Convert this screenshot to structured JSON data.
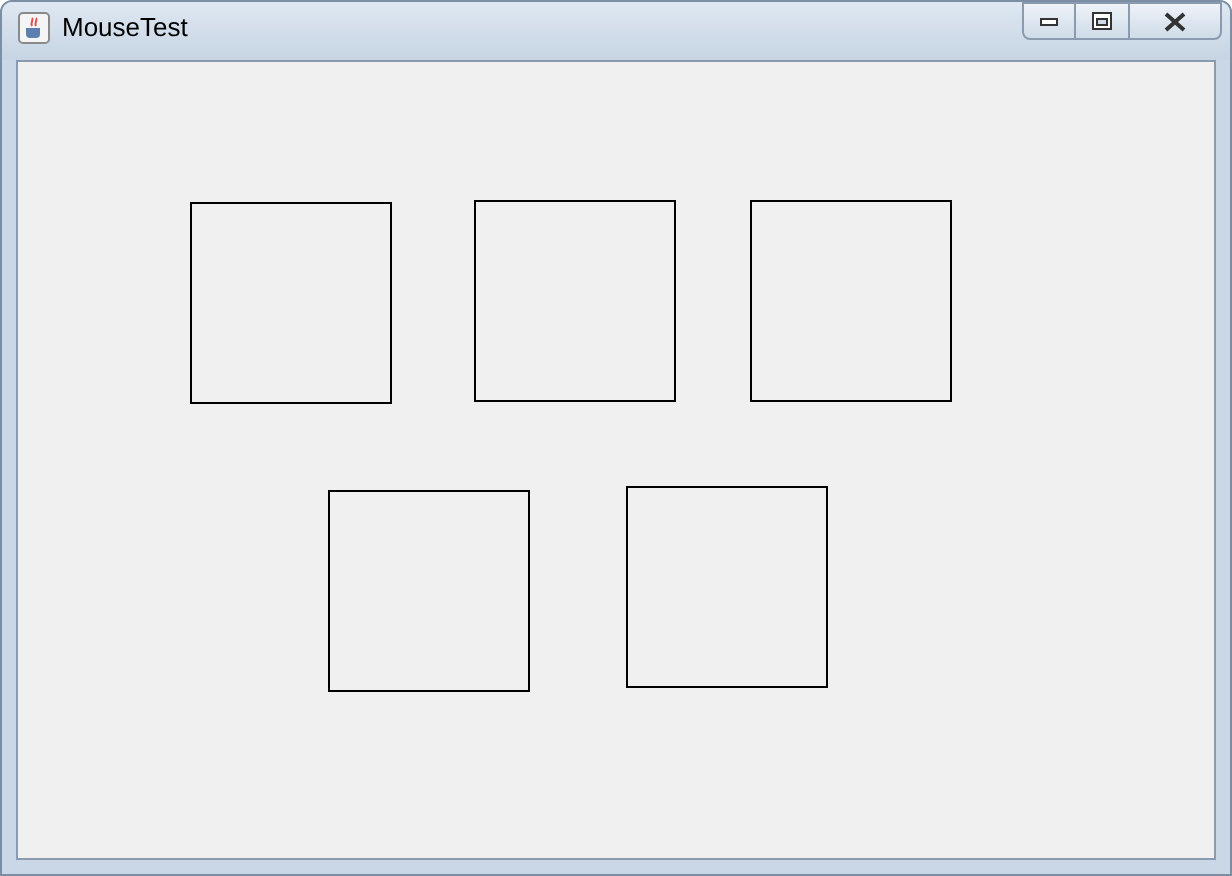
{
  "window": {
    "title": "MouseTest"
  },
  "canvas": {
    "shapes": [
      {
        "kind": "square"
      },
      {
        "kind": "square"
      },
      {
        "kind": "square"
      },
      {
        "kind": "square"
      },
      {
        "kind": "square"
      }
    ]
  }
}
